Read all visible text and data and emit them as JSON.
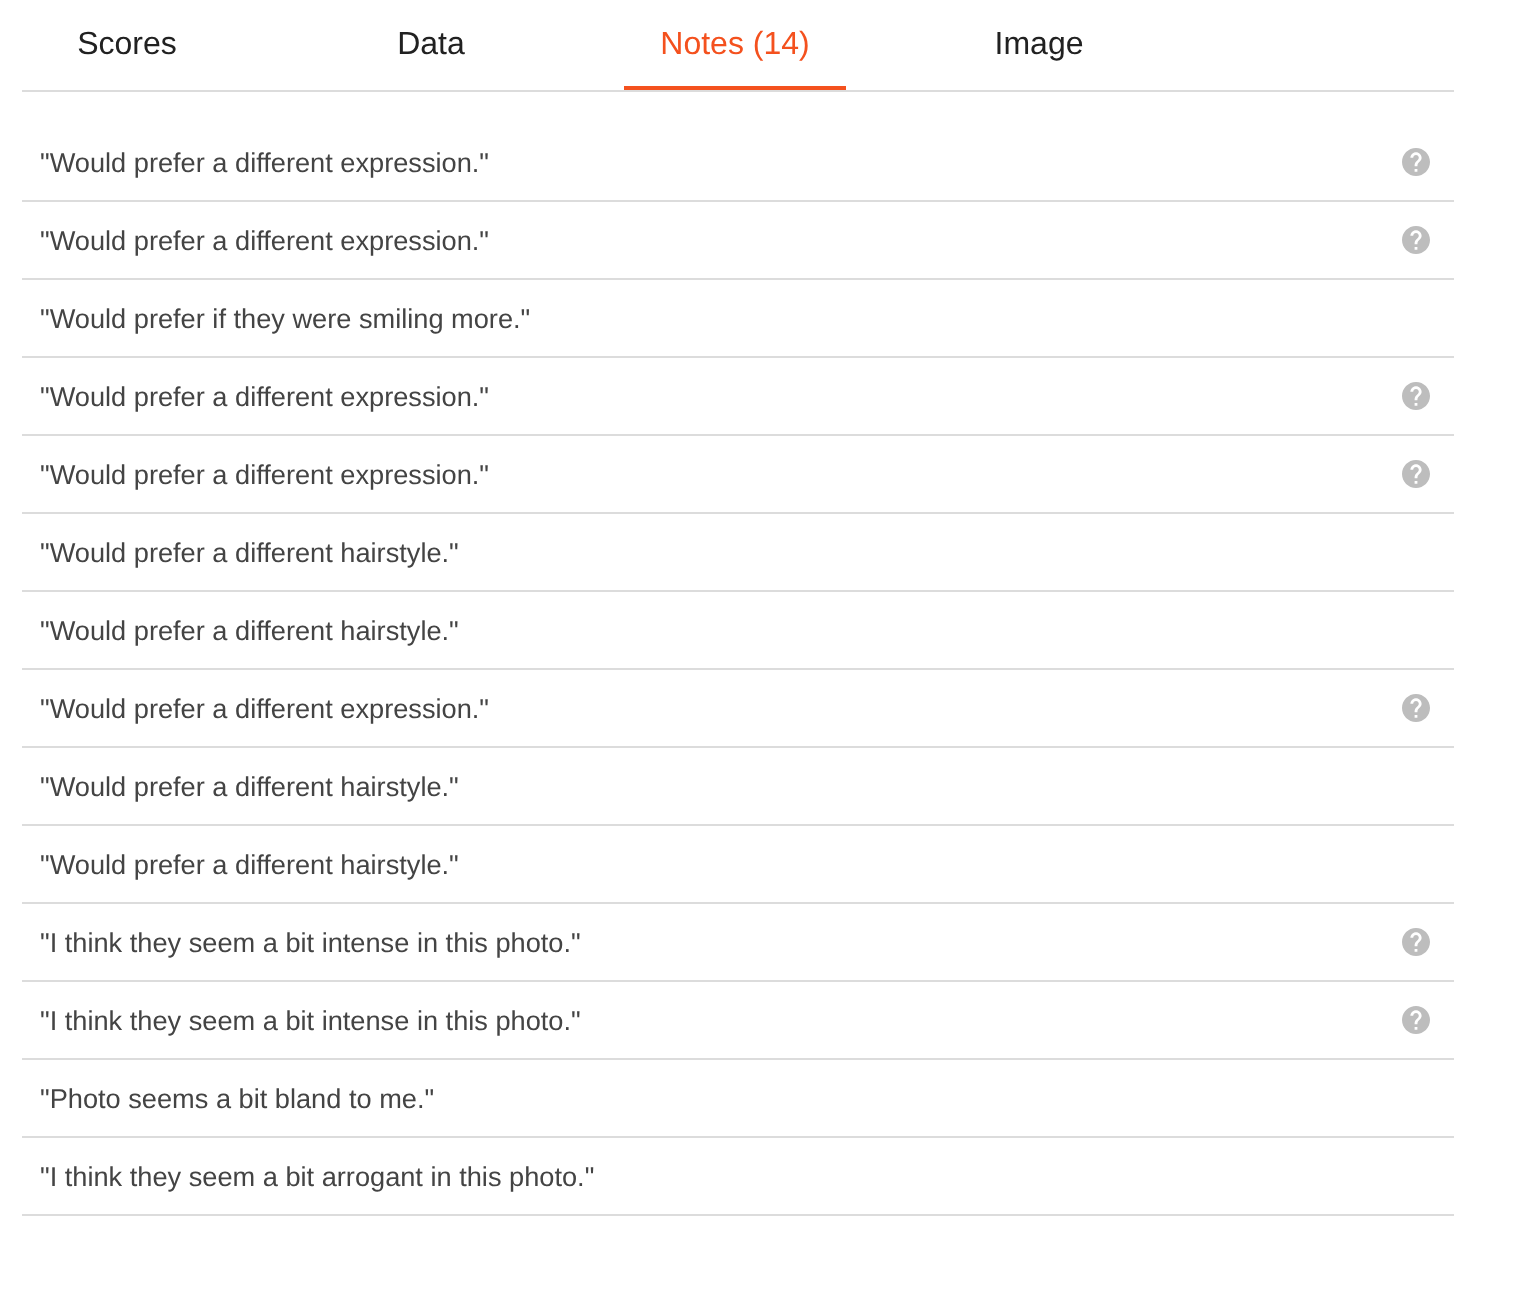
{
  "tabs": [
    {
      "label": "Scores",
      "selected": false
    },
    {
      "label": "Data",
      "selected": false
    },
    {
      "label": "Notes (14)",
      "selected": true
    },
    {
      "label": "Image",
      "selected": false
    }
  ],
  "notes": [
    {
      "text": "\"Would prefer a different expression.\"",
      "help_icon": true
    },
    {
      "text": "\"Would prefer a different expression.\"",
      "help_icon": true
    },
    {
      "text": "\"Would prefer if they were smiling more.\"",
      "help_icon": false
    },
    {
      "text": "\"Would prefer a different expression.\"",
      "help_icon": true
    },
    {
      "text": "\"Would prefer a different expression.\"",
      "help_icon": true
    },
    {
      "text": "\"Would prefer a different hairstyle.\"",
      "help_icon": false
    },
    {
      "text": "\"Would prefer a different hairstyle.\"",
      "help_icon": false
    },
    {
      "text": "\"Would prefer a different expression.\"",
      "help_icon": true
    },
    {
      "text": "\"Would prefer a different hairstyle.\"",
      "help_icon": false
    },
    {
      "text": "\"Would prefer a different hairstyle.\"",
      "help_icon": false
    },
    {
      "text": "\"I think they seem a bit intense in this photo.\"",
      "help_icon": true
    },
    {
      "text": "\"I think they seem a bit intense in this photo.\"",
      "help_icon": true
    },
    {
      "text": "\"Photo seems a bit bland to me.\"",
      "help_icon": false
    },
    {
      "text": "\"I think they seem a bit arrogant in this photo.\"",
      "help_icon": false
    }
  ]
}
